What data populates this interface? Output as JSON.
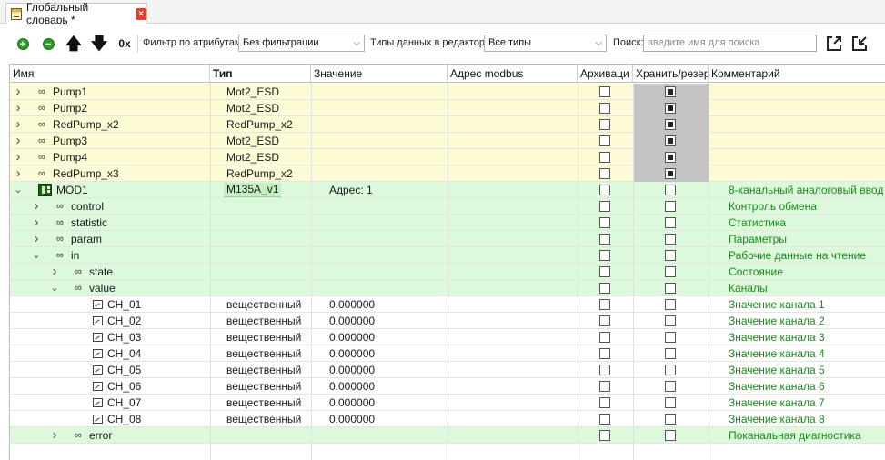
{
  "tab": {
    "title": "Глобальный словарь *",
    "close": "×"
  },
  "toolbar": {
    "add_icon": "plus-circle",
    "remove_icon": "minus-circle",
    "up_icon": "arrow-up",
    "down_icon": "arrow-down",
    "zero_label": "0x",
    "filter_label": "Фильтр по атрибутам:",
    "filter_value": "Без фильтрации",
    "types_label": "Типы данных в редакторе:",
    "types_value": "Все типы",
    "search_label": "Поиск:",
    "search_placeholder": "введите имя для поиска",
    "export_icon": "export-icon",
    "import_icon": "import-icon"
  },
  "columns": {
    "name": "Имя",
    "type": "Тип",
    "value": "Значение",
    "modbus": "Адрес modbus",
    "archive": "Архиваци",
    "store": "Хранить/резер",
    "comment": "Комментарий"
  },
  "colors": {
    "yellow_row": "#fcfbd6",
    "green_row": "#dcf9dc",
    "comment_green": "#1b8a1b",
    "tab_close": "#e2412f"
  },
  "rows": [
    {
      "name": "Pump1",
      "type": "Mot2_ESD",
      "value": "",
      "comment": "",
      "level": 0,
      "expander": "collapsed",
      "icon": "link",
      "bg": "yellow",
      "archive": false,
      "store": true
    },
    {
      "name": "Pump2",
      "type": "Mot2_ESD",
      "value": "",
      "comment": "",
      "level": 0,
      "expander": "collapsed",
      "icon": "link",
      "bg": "yellow",
      "archive": false,
      "store": true
    },
    {
      "name": "RedPump_x2",
      "type": "RedPump_x2",
      "value": "",
      "comment": "",
      "level": 0,
      "expander": "collapsed",
      "icon": "link",
      "bg": "yellow",
      "archive": false,
      "store": true
    },
    {
      "name": "Pump3",
      "type": "Mot2_ESD",
      "value": "",
      "comment": "",
      "level": 0,
      "expander": "collapsed",
      "icon": "link",
      "bg": "yellow",
      "archive": false,
      "store": true
    },
    {
      "name": "Pump4",
      "type": "Mot2_ESD",
      "value": "",
      "comment": "",
      "level": 0,
      "expander": "collapsed",
      "icon": "link",
      "bg": "yellow",
      "archive": false,
      "store": true
    },
    {
      "name": "RedPump_x3",
      "type": "RedPump_x2",
      "value": "",
      "comment": "",
      "level": 0,
      "expander": "collapsed",
      "icon": "link",
      "bg": "yellow",
      "archive": false,
      "store": true
    },
    {
      "name": "MOD1",
      "type": "M135A_v1",
      "value": "Адрес: 1",
      "comment": "8-канальный аналоговый ввод",
      "level": 0,
      "expander": "expanded",
      "icon": "module",
      "bg": "green",
      "archive": false,
      "store": false
    },
    {
      "name": "control",
      "type": "",
      "value": "",
      "comment": "Контроль обмена",
      "level": 1,
      "expander": "collapsed",
      "icon": "link",
      "bg": "green",
      "archive": false,
      "store": false
    },
    {
      "name": "statistic",
      "type": "",
      "value": "",
      "comment": "Статистика",
      "level": 1,
      "expander": "collapsed",
      "icon": "link",
      "bg": "green",
      "archive": false,
      "store": false
    },
    {
      "name": "param",
      "type": "",
      "value": "",
      "comment": "Параметры",
      "level": 1,
      "expander": "collapsed",
      "icon": "link",
      "bg": "green",
      "archive": false,
      "store": false
    },
    {
      "name": "in",
      "type": "",
      "value": "",
      "comment": "Рабочие данные на чтение",
      "level": 1,
      "expander": "expanded",
      "icon": "link",
      "bg": "green",
      "archive": false,
      "store": false
    },
    {
      "name": "state",
      "type": "",
      "value": "",
      "comment": "Состояние",
      "level": 2,
      "expander": "collapsed",
      "icon": "link",
      "bg": "green",
      "archive": false,
      "store": false
    },
    {
      "name": "value",
      "type": "",
      "value": "",
      "comment": "Каналы",
      "level": 2,
      "expander": "expanded",
      "icon": "link",
      "bg": "green",
      "archive": false,
      "store": false
    },
    {
      "name": "CH_01",
      "type": "вещественный",
      "value": "0.000000",
      "comment": "Значение канала  1",
      "level": 3,
      "expander": "none",
      "icon": "image",
      "bg": "white",
      "archive": false,
      "store": false
    },
    {
      "name": "CH_02",
      "type": "вещественный",
      "value": "0.000000",
      "comment": "Значение канала  2",
      "level": 3,
      "expander": "none",
      "icon": "image",
      "bg": "white",
      "archive": false,
      "store": false
    },
    {
      "name": "CH_03",
      "type": "вещественный",
      "value": "0.000000",
      "comment": "Значение канала  3",
      "level": 3,
      "expander": "none",
      "icon": "image",
      "bg": "white",
      "archive": false,
      "store": false
    },
    {
      "name": "CH_04",
      "type": "вещественный",
      "value": "0.000000",
      "comment": "Значение канала  4",
      "level": 3,
      "expander": "none",
      "icon": "image",
      "bg": "white",
      "archive": false,
      "store": false
    },
    {
      "name": "CH_05",
      "type": "вещественный",
      "value": "0.000000",
      "comment": "Значение канала  5",
      "level": 3,
      "expander": "none",
      "icon": "image",
      "bg": "white",
      "archive": false,
      "store": false
    },
    {
      "name": "CH_06",
      "type": "вещественный",
      "value": "0.000000",
      "comment": "Значение канала  6",
      "level": 3,
      "expander": "none",
      "icon": "image",
      "bg": "white",
      "archive": false,
      "store": false
    },
    {
      "name": "CH_07",
      "type": "вещественный",
      "value": "0.000000",
      "comment": "Значение канала  7",
      "level": 3,
      "expander": "none",
      "icon": "image",
      "bg": "white",
      "archive": false,
      "store": false
    },
    {
      "name": "CH_08",
      "type": "вещественный",
      "value": "0.000000",
      "comment": "Значение канала  8",
      "level": 3,
      "expander": "none",
      "icon": "image",
      "bg": "white",
      "archive": false,
      "store": false
    },
    {
      "name": "error",
      "type": "",
      "value": "",
      "comment": "Поканальная диагностика",
      "level": 2,
      "expander": "collapsed",
      "icon": "link",
      "bg": "green",
      "archive": false,
      "store": false
    }
  ]
}
